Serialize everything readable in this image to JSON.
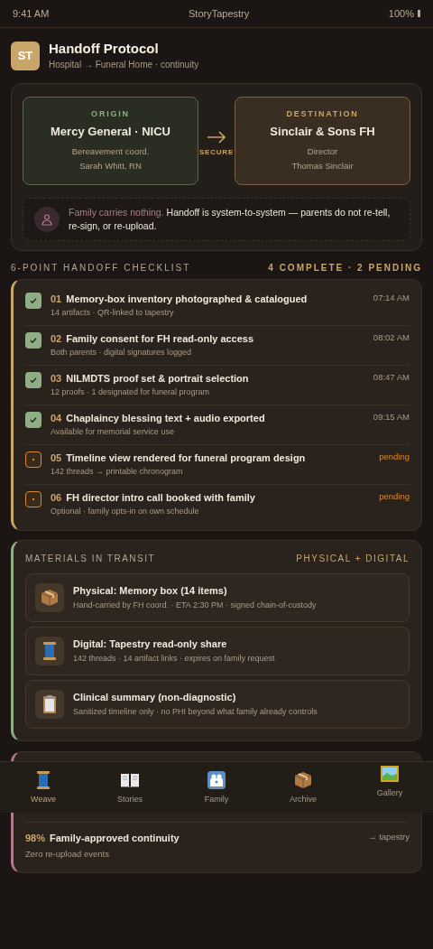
{
  "status_bar": {
    "time": "9:41 AM",
    "app": "StoryTapestry",
    "battery": "100%"
  },
  "header": {
    "badge": "ST",
    "title": "Handoff Protocol",
    "subtitle": "Hospital → Funeral Home · continuity"
  },
  "handoff": {
    "origin": {
      "label": "ORIGIN",
      "name": "Mercy General · NICU",
      "role": "Bereavement coord.",
      "person": "Sarah Whitt, RN"
    },
    "link": "SECURE",
    "destination": {
      "label": "DESTINATION",
      "name": "Sinclair & Sons FH",
      "role": "Director",
      "person": "Thomas Sinclair"
    },
    "note_lead": "Family carries nothing.",
    "note": "Handoff is system-to-system — parents do not re-tell, re-sign, or re-upload."
  },
  "checklist": {
    "title": "6-POINT HANDOFF CHECKLIST",
    "summary": "4 COMPLETE · 2 PENDING",
    "items": [
      {
        "number": "01",
        "title": "Memory-box inventory photographed & catalogued",
        "detail": "14 artifacts · QR-linked to tapestry",
        "status": "07:14 AM",
        "checked": true
      },
      {
        "number": "02",
        "title": "Family consent for FH read-only access",
        "detail": "Both parents · digital signatures logged",
        "status": "08:02 AM",
        "checked": true
      },
      {
        "number": "03",
        "title": "NILMDTS proof set & portrait selection",
        "detail": "12 proofs · 1 designated for funeral program",
        "status": "08:47 AM",
        "checked": true
      },
      {
        "number": "04",
        "title": "Chaplaincy blessing text + audio exported",
        "detail": "Available for memorial service use",
        "status": "09:15 AM",
        "checked": true
      },
      {
        "number": "05",
        "title": "Timeline view rendered for funeral program design",
        "detail": "142 threads → printable chronogram",
        "status": "pending",
        "checked": false
      },
      {
        "number": "06",
        "title": "FH director intro call booked with family",
        "detail": "Optional · family opts-in on own schedule",
        "status": "pending",
        "checked": false
      }
    ]
  },
  "materials": {
    "title": "MATERIALS IN TRANSIT",
    "tag": "PHYSICAL + DIGITAL",
    "items": [
      {
        "kind": "box",
        "title": "Physical: Memory box (14 items)",
        "detail": "Hand-carried by FH coord. · ETA 2:30 PM · signed chain-of-custody"
      },
      {
        "kind": "spool",
        "title": "Digital: Tapestry read-only share",
        "detail": "142 threads · 14 artifact links · expires on family request"
      },
      {
        "kind": "clipboard",
        "title": "Clinical summary (non-diagnostic)",
        "detail": "Sanitized timeline only · no PHI beyond what family already controls"
      }
    ]
  },
  "stats": {
    "rows": [
      {
        "value": "98%",
        "title": "Family-approved continuity",
        "detail": "Zero re-upload events",
        "link": "→ tapestry"
      }
    ]
  },
  "nav": [
    {
      "kind": "spool",
      "label": "Weave",
      "selected": true
    },
    {
      "kind": "book",
      "label": "Stories",
      "selected": false
    },
    {
      "kind": "family",
      "label": "Family",
      "selected": false
    },
    {
      "kind": "box",
      "label": "Archive",
      "selected": false
    },
    {
      "kind": "picture",
      "label": "Gallery",
      "selected": false
    }
  ]
}
